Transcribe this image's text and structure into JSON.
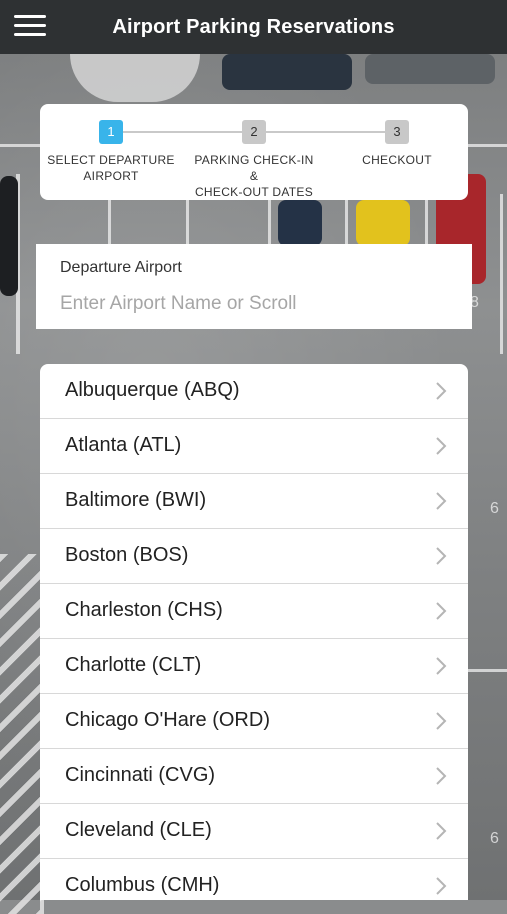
{
  "header": {
    "title": "Airport Parking Reservations"
  },
  "stepper": {
    "steps": [
      {
        "number": "1",
        "label_line1": "SELECT DEPARTURE",
        "label_line2": "AIRPORT",
        "state": "active"
      },
      {
        "number": "2",
        "label_line1": "PARKING CHECK-IN &",
        "label_line2": "CHECK-OUT DATES",
        "state": "inactive"
      },
      {
        "number": "3",
        "label_line1": "CHECKOUT",
        "label_line2": "",
        "state": "inactive"
      }
    ]
  },
  "departure": {
    "label": "Departure Airport",
    "placeholder": "Enter Airport Name or Scroll",
    "value": ""
  },
  "airports": [
    {
      "name": "Albuquerque (ABQ)"
    },
    {
      "name": "Atlanta (ATL)"
    },
    {
      "name": "Baltimore (BWI)"
    },
    {
      "name": "Boston (BOS)"
    },
    {
      "name": "Charleston (CHS)"
    },
    {
      "name": "Charlotte (CLT)"
    },
    {
      "name": "Chicago O'Hare (ORD)"
    },
    {
      "name": "Cincinnati (CVG)"
    },
    {
      "name": "Cleveland (CLE)"
    },
    {
      "name": "Columbus (CMH)"
    }
  ],
  "background": {
    "painted_numbers": [
      "8",
      "6",
      "6"
    ]
  },
  "colors": {
    "header_bg": "#2e3133",
    "active_step": "#38b4ea",
    "inactive_step": "#c8c8c8"
  },
  "icons": {
    "menu": "hamburger-menu-icon",
    "row_chevron": "chevron-right-icon"
  }
}
